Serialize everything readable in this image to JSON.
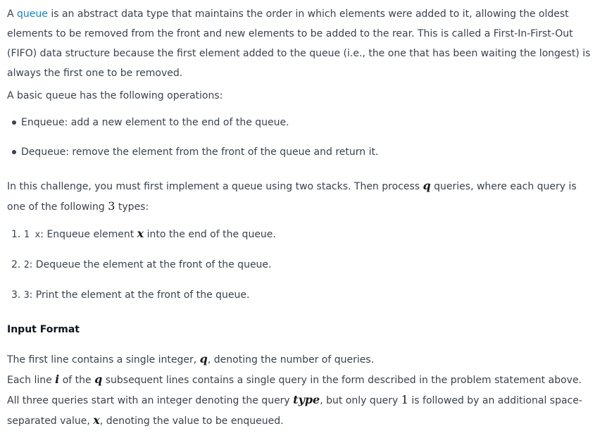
{
  "intro": {
    "lead": "A ",
    "link": "queue",
    "text": " is an abstract data type that maintains the order in which elements were added to it, allowing the oldest elements to be removed from the front and new elements to be added to the rear. This is called a First-In-First-Out (FIFO) data structure because the first element added to the queue (i.e., the one that has been waiting the longest) is always the first one to be removed."
  },
  "ops_intro": "A basic queue has the following operations:",
  "operations": [
    "Enqueue: add a new element to the end of the queue.",
    "Dequeue: remove the element from the front of the queue and return it."
  ],
  "challenge": {
    "part1": "In this challenge, you must first implement a queue using two stacks. Then process ",
    "q": "q",
    "part2": " queries, where each query is one of the following ",
    "three": "3",
    "part3": " types:"
  },
  "types": [
    {
      "num": "1.",
      "code": "1 x",
      "mid": ": Enqueue element ",
      "var": "x",
      "rest": " into the end of the queue."
    },
    {
      "num": "2.",
      "code": "2",
      "rest": ": Dequeue the element at the front of the queue."
    },
    {
      "num": "3.",
      "code": "3",
      "rest": ": Print the element at the front of the queue."
    }
  ],
  "input_format": {
    "heading": "Input Format",
    "line1_a": "The first line contains a single integer, ",
    "line1_q": "q",
    "line1_b": ", denoting the number of queries.",
    "line2_a": "Each line ",
    "line2_i": "i",
    "line2_b": " of the ",
    "line2_q": "q",
    "line2_c": " subsequent lines contains a single query in the form described in the problem statement above. All three queries start with an integer denoting the query ",
    "line2_type": "type",
    "line2_d": ", but only query ",
    "line2_one": "1",
    "line2_e": " is followed by an additional space-separated value, ",
    "line2_x": "x",
    "line2_f": ", denoting the value to be enqueued."
  }
}
